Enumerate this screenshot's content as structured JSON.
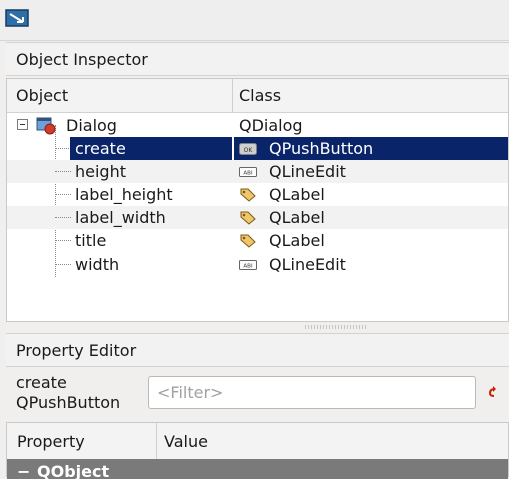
{
  "object_inspector": {
    "title": "Object Inspector",
    "columns": {
      "object": "Object",
      "class": "Class"
    },
    "rows": [
      {
        "name": "Dialog",
        "class": "QDialog",
        "icon": "dialog-icon",
        "class_icon": ""
      },
      {
        "name": "create",
        "class": "QPushButton",
        "icon": "",
        "class_icon": "push-button-icon",
        "selected": true
      },
      {
        "name": "height",
        "class": "QLineEdit",
        "icon": "",
        "class_icon": "line-edit-icon"
      },
      {
        "name": "label_height",
        "class": "QLabel",
        "icon": "",
        "class_icon": "label-tag-icon"
      },
      {
        "name": "label_width",
        "class": "QLabel",
        "icon": "",
        "class_icon": "label-tag-icon"
      },
      {
        "name": "title",
        "class": "QLabel",
        "icon": "",
        "class_icon": "label-tag-icon"
      },
      {
        "name": "width",
        "class": "QLineEdit",
        "icon": "",
        "class_icon": "line-edit-icon"
      }
    ]
  },
  "property_editor": {
    "title": "Property Editor",
    "object_name": "create",
    "object_class": "QPushButton",
    "filter": {
      "value": "",
      "placeholder": "<Filter>"
    },
    "columns": {
      "property": "Property",
      "value": "Value"
    },
    "group": {
      "toggle": "−",
      "name": "QObject"
    }
  },
  "colors": {
    "selection": "#0a246a",
    "group_header": "#7a7a7a",
    "reset_icon": "#cc2200"
  }
}
